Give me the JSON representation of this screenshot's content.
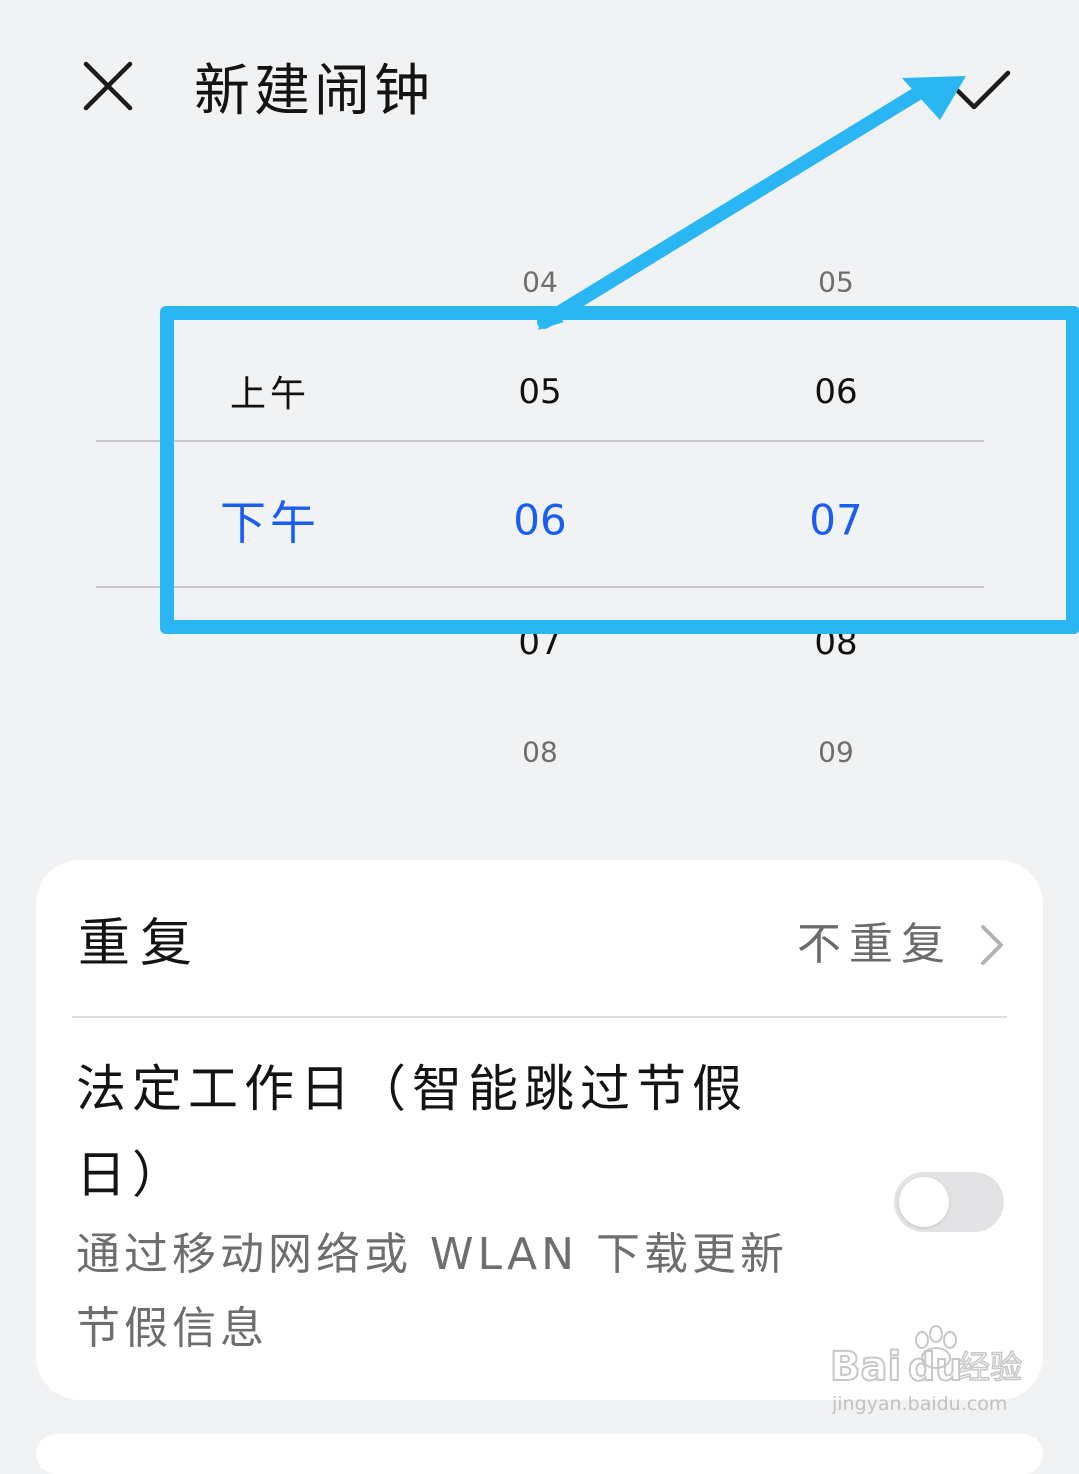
{
  "header": {
    "title": "新建闹钟",
    "close_icon": "close-icon",
    "confirm_icon": "check-icon"
  },
  "picker": {
    "ampm": {
      "options": [
        "上午",
        "下午"
      ],
      "selected": "下午"
    },
    "hour": {
      "values": [
        "04",
        "05",
        "06",
        "07",
        "08"
      ],
      "selected": "06"
    },
    "minute": {
      "values": [
        "05",
        "06",
        "07",
        "08",
        "09"
      ],
      "selected": "07"
    }
  },
  "settings": {
    "repeat": {
      "label": "重复",
      "value": "不重复"
    },
    "workday": {
      "title": "法定工作日（智能跳过节假日）",
      "subtitle": "通过移动网络或 WLAN 下载更新节假信息",
      "enabled": false
    }
  },
  "annotation": {
    "color": "#29b6f2",
    "icons": [
      "arrow-annotation",
      "highlight-box"
    ]
  },
  "watermark": {
    "brand": "Bai",
    "brand2": "du",
    "suffix": "经验",
    "url": "jingyan.baidu.com"
  },
  "colors": {
    "accent": "#1a5ef0",
    "background": "#f1f2f4",
    "card": "#ffffff"
  }
}
